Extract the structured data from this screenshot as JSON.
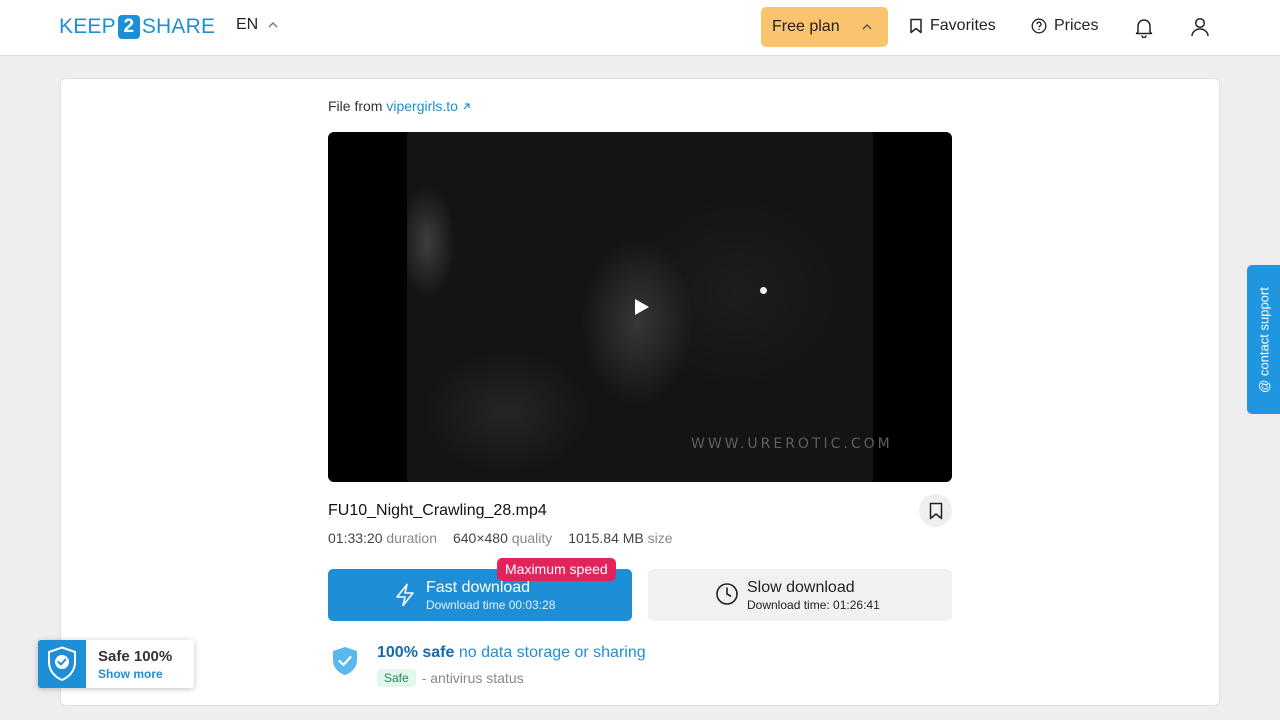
{
  "header": {
    "logo": {
      "left": "KEEP",
      "middle": "2",
      "right": "SHARE"
    },
    "language": "EN",
    "plan_label": "Free plan",
    "favorites_label": "Favorites",
    "prices_label": "Prices"
  },
  "file": {
    "from_label": "File from",
    "source_link": "vipergirls.to",
    "name": "FU10_Night_Crawling_28.mp4",
    "duration_value": "01:33:20",
    "duration_label": "duration",
    "quality_value": "640×480",
    "quality_label": "quality",
    "size_value": "1015.84 MB",
    "size_label": "size"
  },
  "player": {
    "watermark": "WWW.URЕROTIC.COM"
  },
  "download": {
    "fast_label": "Fast download",
    "fast_time": "Download time 00:03:28",
    "badge": "Maximum speed",
    "slow_label": "Slow download",
    "slow_time": "Download time: 01:26:41"
  },
  "safety": {
    "strong": "100% safe",
    "rest": "no data storage or sharing",
    "tag": "Safe",
    "status": "- antivirus status"
  },
  "contact": {
    "label": "@ contact support"
  },
  "widget": {
    "title": "Safe 100%",
    "link": "Show more"
  },
  "colors": {
    "brand": "#1e8fd6",
    "plan": "#fac46f",
    "badge": "#e2245b"
  }
}
